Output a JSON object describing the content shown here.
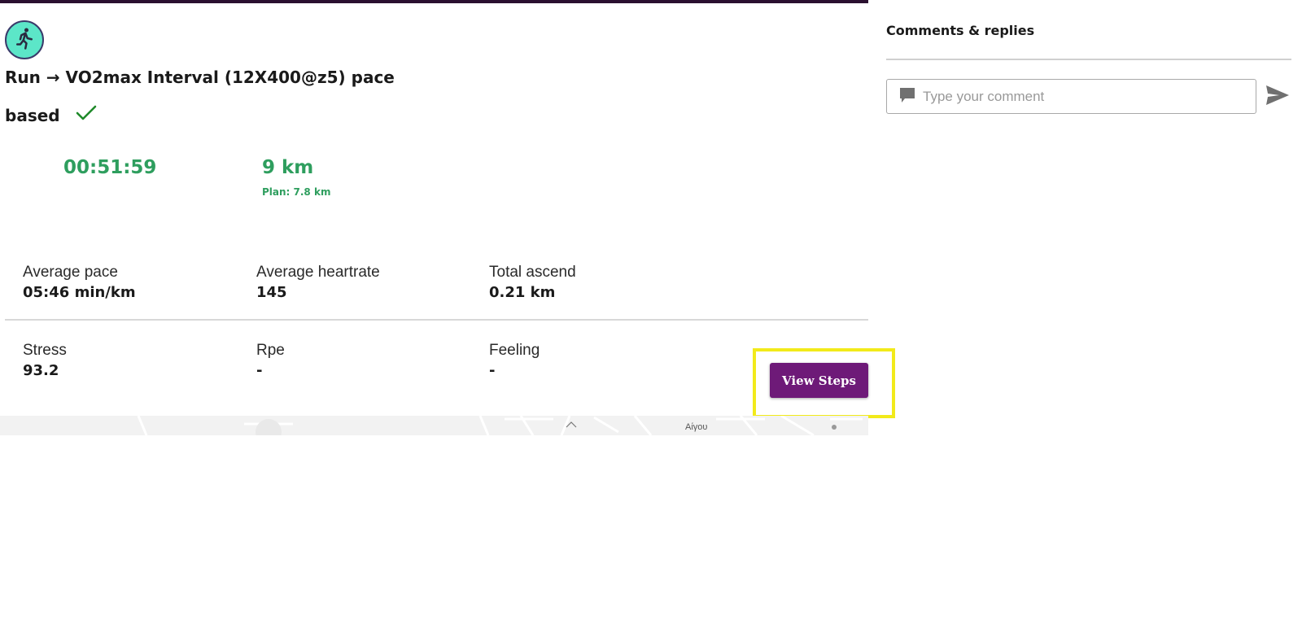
{
  "workout": {
    "title_line1": "Run → VO2max Interval (12X400@z5) pace",
    "title_line2": "based",
    "duration": "00:51:59",
    "distance": "9 km",
    "plan": "Plan: 7.8 km"
  },
  "stats_row1": [
    {
      "label": "Average pace",
      "value": "05:46 min/km"
    },
    {
      "label": "Average heartrate",
      "value": "145"
    },
    {
      "label": "Total ascend",
      "value": "0.21 km"
    }
  ],
  "stats_row2": [
    {
      "label": "Stress",
      "value": "93.2"
    },
    {
      "label": "Rpe",
      "value": "-"
    },
    {
      "label": "Feeling",
      "value": "-"
    }
  ],
  "actions": {
    "view_steps": "View Steps"
  },
  "map": {
    "place_label": "Αίγου"
  },
  "comments": {
    "title": "Comments & replies",
    "placeholder": "Type your comment"
  },
  "colors": {
    "accent_purple": "#6e1a78",
    "metric_green": "#2e9e5e",
    "avatar_teal": "#5ce6c8",
    "highlight_yellow": "#f2ea1a",
    "check_green": "#1f8a2a"
  },
  "icons": {
    "activity": "runner-icon",
    "completed": "checkmark-icon",
    "comment": "speech-bubble-icon",
    "send": "send-icon"
  }
}
